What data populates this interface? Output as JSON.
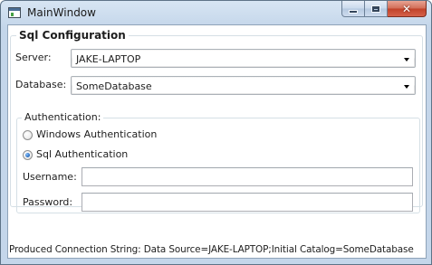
{
  "window": {
    "title": "MainWindow",
    "close_glyph": "✕"
  },
  "sql_config": {
    "header": "Sql Configuration",
    "server_label": "Server:",
    "server_value": "JAKE-LAPTOP",
    "database_label": "Database:",
    "database_value": "SomeDatabase"
  },
  "authentication": {
    "header": "Authentication:",
    "options": [
      {
        "label": "Windows Authentication",
        "checked": false
      },
      {
        "label": "Sql Authentication",
        "checked": true
      }
    ],
    "username_label": "Username:",
    "username_value": "",
    "password_label": "Password:",
    "password_value": ""
  },
  "status": {
    "text": "Produced Connection String: Data Source=JAKE-LAPTOP;Initial Catalog=SomeDatabase"
  },
  "colors": {
    "window_frame": "#c4d6ea",
    "close_button": "#c14128",
    "radio_selected": "#2e72c2"
  }
}
